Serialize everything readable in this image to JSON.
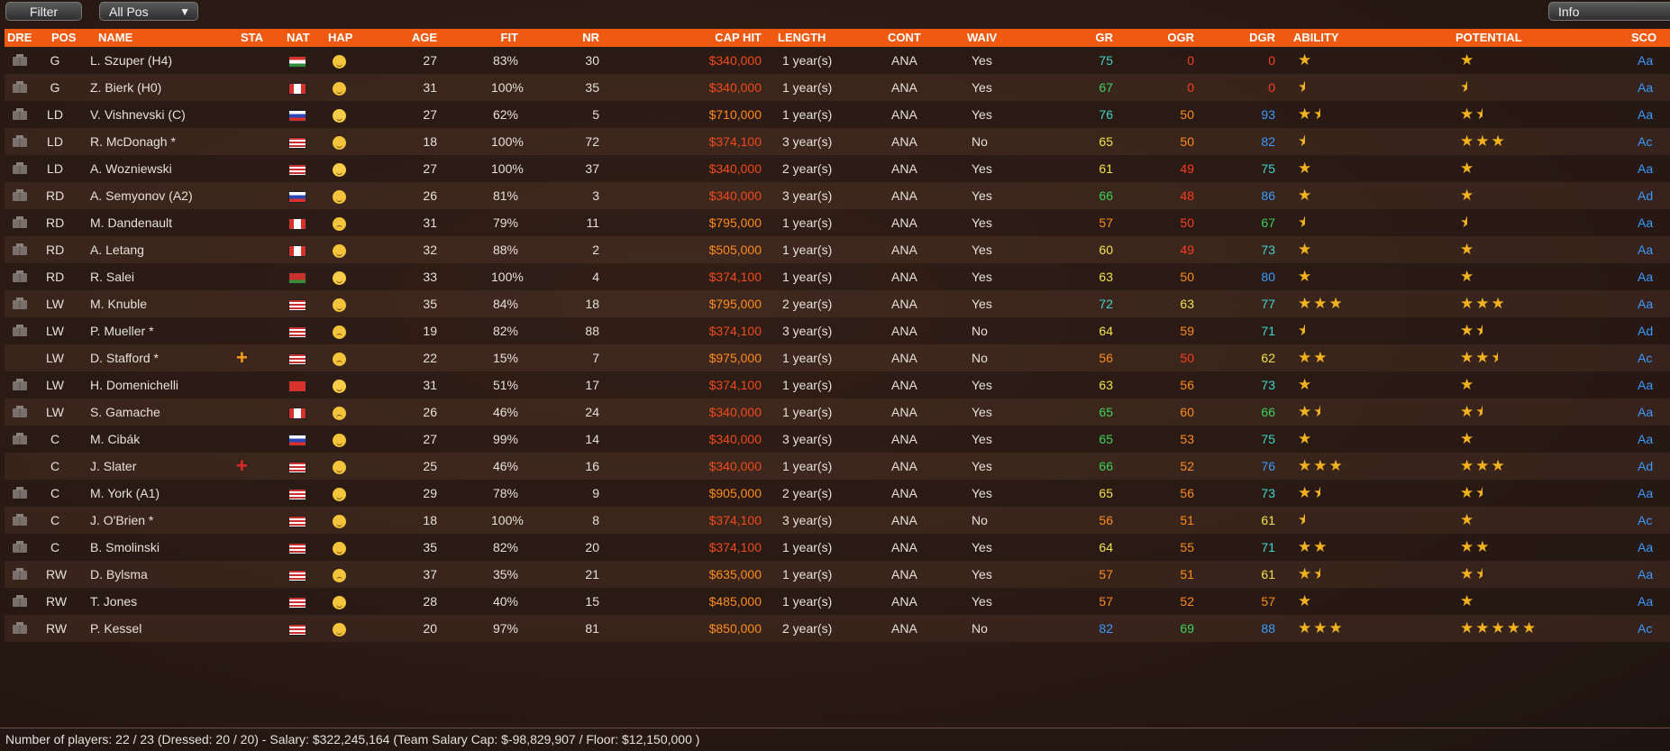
{
  "toolbar": {
    "filter_label": "Filter",
    "pos_label": "All Pos",
    "info_label": "Info"
  },
  "headers": {
    "dre": "DRE",
    "pos": "POS",
    "name": "NAME",
    "sta": "STA",
    "nat": "NAT",
    "hap": "HAP",
    "age": "AGE",
    "fit": "FIT",
    "nr": "NR",
    "cap": "CAP HIT",
    "length": "LENGTH",
    "cont": "CONT",
    "waiv": "WAIV",
    "gr": "GR",
    "ogr": "OGR",
    "dgr": "DGR",
    "ability": "ABILITY",
    "potential": "POTENTIAL",
    "sco": "SCO"
  },
  "colors": {
    "header_bg": "#f05a10",
    "cap_red": "#f04a1a",
    "cap_orange": "#ff8c1a",
    "green": "#3bd35a",
    "yellow": "#f2e24a",
    "orange": "#ff8c1a",
    "red": "#ff3b1f",
    "cyan": "#3fd6c8",
    "blue": "#3a9aff",
    "sco": "#3a9aff"
  },
  "rows": [
    {
      "pos": "G",
      "name": "L. Szuper (H4)",
      "sta": "",
      "nat": "hungary",
      "hap": "neutral",
      "age": "27",
      "fit": "83%",
      "nr": "30",
      "cap": "$340,000",
      "cap_color": "red",
      "length": "1 year(s)",
      "cont": "ANA",
      "waiv": "Yes",
      "gr": "75",
      "gr_c": "cyan",
      "ogr": "0",
      "ogr_c": "red",
      "dgr": "0",
      "dgr_c": "red",
      "ability": 1,
      "potential": 1,
      "sco": "Aa"
    },
    {
      "pos": "G",
      "name": "Z. Bierk (H0)",
      "sta": "",
      "nat": "canada",
      "hap": "neutral",
      "age": "31",
      "fit": "100%",
      "nr": "35",
      "cap": "$340,000",
      "cap_color": "red",
      "length": "1 year(s)",
      "cont": "ANA",
      "waiv": "Yes",
      "gr": "67",
      "gr_c": "green",
      "ogr": "0",
      "ogr_c": "red",
      "dgr": "0",
      "dgr_c": "red",
      "ability": 0.5,
      "potential": 0.5,
      "sco": "Aa"
    },
    {
      "pos": "LD",
      "name": "V. Vishnevski (C)",
      "sta": "",
      "nat": "russia",
      "hap": "grin",
      "age": "27",
      "fit": "62%",
      "nr": "5",
      "cap": "$710,000",
      "cap_color": "orange",
      "length": "1 year(s)",
      "cont": "ANA",
      "waiv": "Yes",
      "gr": "76",
      "gr_c": "cyan",
      "ogr": "50",
      "ogr_c": "orange",
      "dgr": "93",
      "dgr_c": "blue",
      "ability": 1.5,
      "potential": 1.5,
      "sco": "Aa"
    },
    {
      "pos": "LD",
      "name": "R. McDonagh *",
      "sta": "",
      "nat": "usa",
      "hap": "neutral",
      "age": "18",
      "fit": "100%",
      "nr": "72",
      "cap": "$374,100",
      "cap_color": "red",
      "length": "3 year(s)",
      "cont": "ANA",
      "waiv": "No",
      "gr": "65",
      "gr_c": "yellow",
      "ogr": "50",
      "ogr_c": "orange",
      "dgr": "82",
      "dgr_c": "blue",
      "ability": 0.5,
      "potential": 3,
      "sco": "Ac"
    },
    {
      "pos": "LD",
      "name": "A. Wozniewski",
      "sta": "",
      "nat": "usa",
      "hap": "grin",
      "age": "27",
      "fit": "100%",
      "nr": "37",
      "cap": "$340,000",
      "cap_color": "red",
      "length": "2 year(s)",
      "cont": "ANA",
      "waiv": "Yes",
      "gr": "61",
      "gr_c": "yellow",
      "ogr": "49",
      "ogr_c": "red",
      "dgr": "75",
      "dgr_c": "cyan",
      "ability": 1,
      "potential": 1,
      "sco": "Aa"
    },
    {
      "pos": "RD",
      "name": "A. Semyonov (A2)",
      "sta": "",
      "nat": "russia",
      "hap": "neutral",
      "age": "26",
      "fit": "81%",
      "nr": "3",
      "cap": "$340,000",
      "cap_color": "red",
      "length": "3 year(s)",
      "cont": "ANA",
      "waiv": "Yes",
      "gr": "66",
      "gr_c": "green",
      "ogr": "48",
      "ogr_c": "red",
      "dgr": "86",
      "dgr_c": "blue",
      "ability": 1,
      "potential": 1,
      "sco": "Ad"
    },
    {
      "pos": "RD",
      "name": "M. Dandenault",
      "sta": "",
      "nat": "canada",
      "hap": "sad",
      "age": "31",
      "fit": "79%",
      "nr": "11",
      "cap": "$795,000",
      "cap_color": "orange",
      "length": "1 year(s)",
      "cont": "ANA",
      "waiv": "Yes",
      "gr": "57",
      "gr_c": "orange",
      "ogr": "50",
      "ogr_c": "red",
      "dgr": "67",
      "dgr_c": "green",
      "ability": 0.5,
      "potential": 0.5,
      "sco": "Aa"
    },
    {
      "pos": "RD",
      "name": "A. Letang",
      "sta": "",
      "nat": "canada",
      "hap": "neutral",
      "age": "32",
      "fit": "88%",
      "nr": "2",
      "cap": "$505,000",
      "cap_color": "orange",
      "length": "1 year(s)",
      "cont": "ANA",
      "waiv": "Yes",
      "gr": "60",
      "gr_c": "yellow",
      "ogr": "49",
      "ogr_c": "red",
      "dgr": "73",
      "dgr_c": "cyan",
      "ability": 1,
      "potential": 1,
      "sco": "Aa"
    },
    {
      "pos": "RD",
      "name": "R. Salei",
      "sta": "",
      "nat": "belarus",
      "hap": "grin",
      "age": "33",
      "fit": "100%",
      "nr": "4",
      "cap": "$374,100",
      "cap_color": "red",
      "length": "1 year(s)",
      "cont": "ANA",
      "waiv": "Yes",
      "gr": "63",
      "gr_c": "yellow",
      "ogr": "50",
      "ogr_c": "orange",
      "dgr": "80",
      "dgr_c": "blue",
      "ability": 1,
      "potential": 1,
      "sco": "Aa"
    },
    {
      "pos": "LW",
      "name": "M. Knuble",
      "sta": "",
      "nat": "usa",
      "hap": "neutral",
      "age": "35",
      "fit": "84%",
      "nr": "18",
      "cap": "$795,000",
      "cap_color": "orange",
      "length": "2 year(s)",
      "cont": "ANA",
      "waiv": "Yes",
      "gr": "72",
      "gr_c": "cyan",
      "ogr": "63",
      "ogr_c": "yellow",
      "dgr": "77",
      "dgr_c": "cyan",
      "ability": 3,
      "potential": 3,
      "sco": "Aa"
    },
    {
      "pos": "LW",
      "name": "P. Mueller *",
      "sta": "",
      "nat": "usa",
      "hap": "sad",
      "age": "19",
      "fit": "82%",
      "nr": "88",
      "cap": "$374,100",
      "cap_color": "red",
      "length": "3 year(s)",
      "cont": "ANA",
      "waiv": "No",
      "gr": "64",
      "gr_c": "yellow",
      "ogr": "59",
      "ogr_c": "orange",
      "dgr": "71",
      "dgr_c": "cyan",
      "ability": 0.5,
      "potential": 1.5,
      "sco": "Ad"
    },
    {
      "pos": "LW",
      "name": "D. Stafford *",
      "sta": "+",
      "sta_c": "#f2a01e",
      "nat": "usa",
      "hap": "sad",
      "age": "22",
      "fit": "15%",
      "nr": "7",
      "cap": "$975,000",
      "cap_color": "orange",
      "length": "1 year(s)",
      "cont": "ANA",
      "waiv": "No",
      "gr": "56",
      "gr_c": "orange",
      "ogr": "50",
      "ogr_c": "red",
      "dgr": "62",
      "dgr_c": "yellow",
      "ability": 2,
      "potential": 2.5,
      "sco": "Ac",
      "nodre": true
    },
    {
      "pos": "LW",
      "name": "H. Domenichelli",
      "sta": "",
      "nat": "swiss",
      "hap": "grin",
      "age": "31",
      "fit": "51%",
      "nr": "17",
      "cap": "$374,100",
      "cap_color": "red",
      "length": "1 year(s)",
      "cont": "ANA",
      "waiv": "Yes",
      "gr": "63",
      "gr_c": "yellow",
      "ogr": "56",
      "ogr_c": "orange",
      "dgr": "73",
      "dgr_c": "cyan",
      "ability": 1,
      "potential": 1,
      "sco": "Aa"
    },
    {
      "pos": "LW",
      "name": "S. Gamache",
      "sta": "",
      "nat": "canada",
      "hap": "sad",
      "age": "26",
      "fit": "46%",
      "nr": "24",
      "cap": "$340,000",
      "cap_color": "red",
      "length": "1 year(s)",
      "cont": "ANA",
      "waiv": "Yes",
      "gr": "65",
      "gr_c": "green",
      "ogr": "60",
      "ogr_c": "orange",
      "dgr": "66",
      "dgr_c": "green",
      "ability": 1.5,
      "potential": 1.5,
      "sco": "Aa"
    },
    {
      "pos": "C",
      "name": "M. Cibák",
      "sta": "",
      "nat": "slovakia",
      "hap": "neutral",
      "age": "27",
      "fit": "99%",
      "nr": "14",
      "cap": "$340,000",
      "cap_color": "red",
      "length": "3 year(s)",
      "cont": "ANA",
      "waiv": "Yes",
      "gr": "65",
      "gr_c": "green",
      "ogr": "53",
      "ogr_c": "orange",
      "dgr": "75",
      "dgr_c": "cyan",
      "ability": 1,
      "potential": 1,
      "sco": "Aa"
    },
    {
      "pos": "C",
      "name": "J. Slater",
      "sta": "+",
      "sta_c": "#e02a2a",
      "nat": "usa",
      "hap": "neutral",
      "age": "25",
      "fit": "46%",
      "nr": "16",
      "cap": "$340,000",
      "cap_color": "red",
      "length": "1 year(s)",
      "cont": "ANA",
      "waiv": "Yes",
      "gr": "66",
      "gr_c": "green",
      "ogr": "52",
      "ogr_c": "orange",
      "dgr": "76",
      "dgr_c": "blue",
      "ability": 3,
      "potential": 3,
      "sco": "Ad",
      "nodre": true
    },
    {
      "pos": "C",
      "name": "M. York (A1)",
      "sta": "",
      "nat": "usa",
      "hap": "neutral",
      "age": "29",
      "fit": "78%",
      "nr": "9",
      "cap": "$905,000",
      "cap_color": "orange",
      "length": "2 year(s)",
      "cont": "ANA",
      "waiv": "Yes",
      "gr": "65",
      "gr_c": "yellow",
      "ogr": "56",
      "ogr_c": "orange",
      "dgr": "73",
      "dgr_c": "cyan",
      "ability": 1.5,
      "potential": 1.5,
      "sco": "Aa"
    },
    {
      "pos": "C",
      "name": "J. O'Brien *",
      "sta": "",
      "nat": "usa",
      "hap": "neutral",
      "age": "18",
      "fit": "100%",
      "nr": "8",
      "cap": "$374,100",
      "cap_color": "red",
      "length": "3 year(s)",
      "cont": "ANA",
      "waiv": "No",
      "gr": "56",
      "gr_c": "orange",
      "ogr": "51",
      "ogr_c": "orange",
      "dgr": "61",
      "dgr_c": "yellow",
      "ability": 0.5,
      "potential": 1,
      "sco": "Ac"
    },
    {
      "pos": "C",
      "name": "B. Smolinski",
      "sta": "",
      "nat": "usa",
      "hap": "neutral",
      "age": "35",
      "fit": "82%",
      "nr": "20",
      "cap": "$374,100",
      "cap_color": "red",
      "length": "1 year(s)",
      "cont": "ANA",
      "waiv": "Yes",
      "gr": "64",
      "gr_c": "yellow",
      "ogr": "55",
      "ogr_c": "orange",
      "dgr": "71",
      "dgr_c": "cyan",
      "ability": 2,
      "potential": 2,
      "sco": "Aa"
    },
    {
      "pos": "RW",
      "name": "D. Bylsma",
      "sta": "",
      "nat": "usa",
      "hap": "sad",
      "age": "37",
      "fit": "35%",
      "nr": "21",
      "cap": "$635,000",
      "cap_color": "orange",
      "length": "1 year(s)",
      "cont": "ANA",
      "waiv": "Yes",
      "gr": "57",
      "gr_c": "orange",
      "ogr": "51",
      "ogr_c": "orange",
      "dgr": "61",
      "dgr_c": "yellow",
      "ability": 1.5,
      "potential": 1.5,
      "sco": "Aa"
    },
    {
      "pos": "RW",
      "name": "T. Jones",
      "sta": "",
      "nat": "usa",
      "hap": "neutral",
      "age": "28",
      "fit": "40%",
      "nr": "15",
      "cap": "$485,000",
      "cap_color": "orange",
      "length": "1 year(s)",
      "cont": "ANA",
      "waiv": "Yes",
      "gr": "57",
      "gr_c": "orange",
      "ogr": "52",
      "ogr_c": "orange",
      "dgr": "57",
      "dgr_c": "orange",
      "ability": 1,
      "potential": 1,
      "sco": "Aa"
    },
    {
      "pos": "RW",
      "name": "P. Kessel",
      "sta": "",
      "nat": "usa",
      "hap": "neutral",
      "age": "20",
      "fit": "97%",
      "nr": "81",
      "cap": "$850,000",
      "cap_color": "orange",
      "length": "2 year(s)",
      "cont": "ANA",
      "waiv": "No",
      "gr": "82",
      "gr_c": "blue",
      "ogr": "69",
      "ogr_c": "green",
      "dgr": "88",
      "dgr_c": "blue",
      "ability": 3,
      "potential": 5,
      "sco": "Ac"
    }
  ],
  "footer": "Number of players: 22 / 23 (Dressed: 20 / 20)  -   Salary: $322,245,164  (Team Salary Cap: $-98,829,907 / Floor: $12,150,000 )"
}
